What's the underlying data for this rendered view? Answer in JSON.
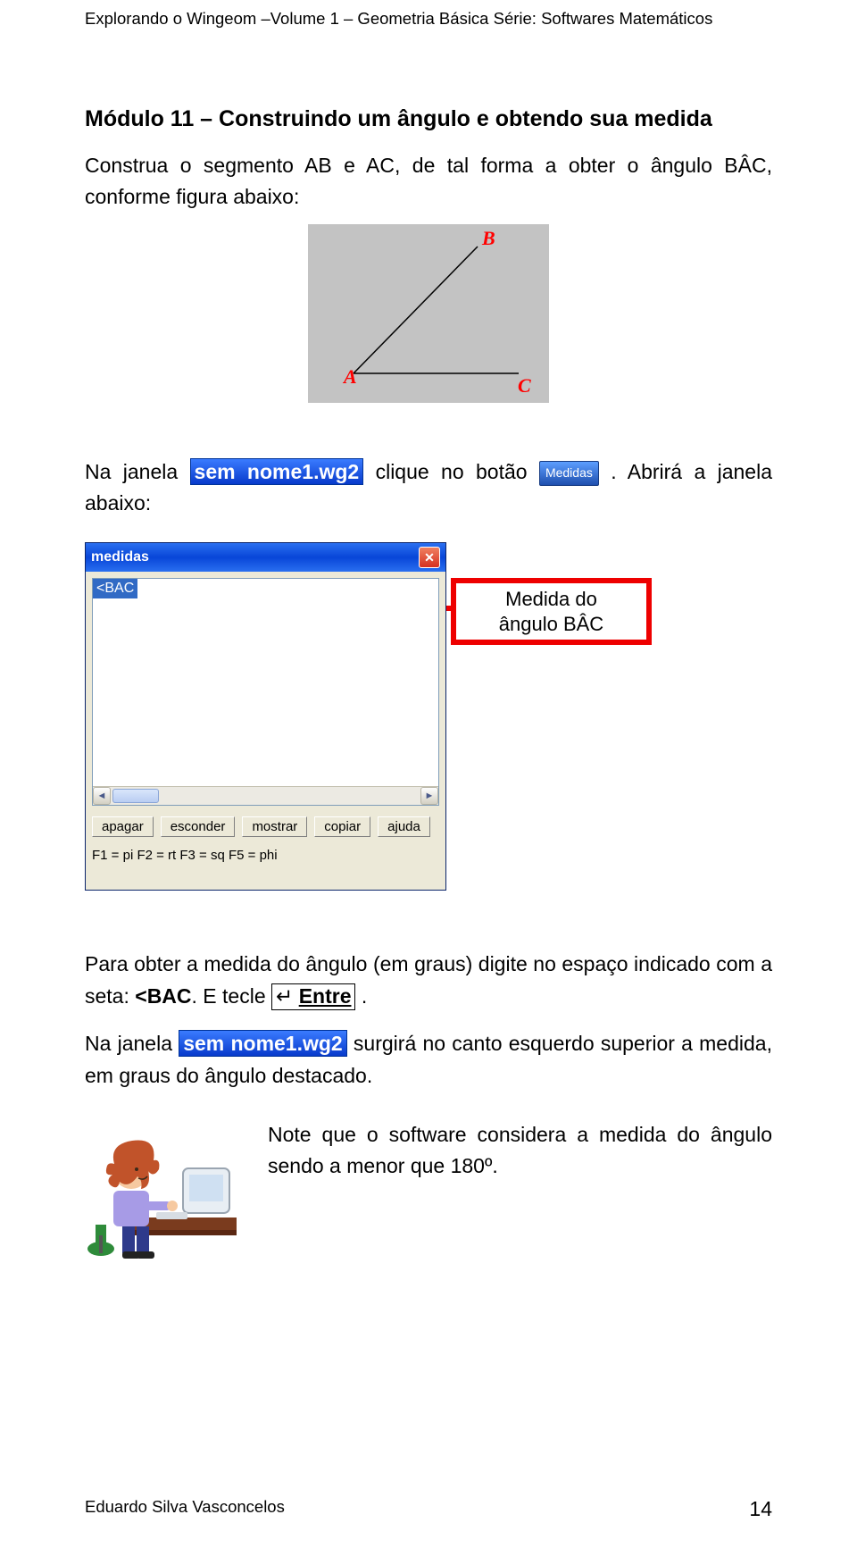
{
  "header": "Explorando o Wingeom –Volume 1 – Geometria Básica  Série: Softwares Matemáticos",
  "section_title": "Módulo 11 – Construindo um ângulo e obtendo sua medida",
  "intro_text": {
    "pre": "Construa o segmento AB e AC, de tal forma a obter o ângulo BÂC, conforme figura abaixo:"
  },
  "angle_figure": {
    "point_a": "A",
    "point_b": "B",
    "point_c": "C"
  },
  "line2": {
    "pre": "Na janela ",
    "hl": "sem nome1.wg2",
    "mid": " clique no botão ",
    "btn": "Medidas",
    "post": ". Abrirá a janela abaixo:"
  },
  "dialog": {
    "title": "medidas",
    "list_item": "<BAC",
    "buttons": [
      "apagar",
      "esconder",
      "mostrar",
      "copiar",
      "ajuda"
    ],
    "fkeys": "F1 = pi   F2 = rt   F3 = sq   F5 = phi"
  },
  "callout": {
    "line1": "Medida do",
    "line2": "ângulo BÂC"
  },
  "para2": {
    "pre": "Para obter a medida do ângulo (em graus) digite no espaço indicado com a seta: ",
    "bac": "<BAC",
    "etecle": ". E tecle ",
    "entre_symbol": "↵ ",
    "entre_label": "Entre",
    "period": " ."
  },
  "para3": {
    "pre": "Na janela ",
    "hl": "sem nome1.wg2",
    "post": " surgirá no canto esquerdo superior a medida, em graus do ângulo destacado."
  },
  "note_text": "Note que o software considera a medida do ângulo sendo a menor que 180º.",
  "footer": {
    "author": "Eduardo Silva Vasconcelos",
    "page": "14"
  }
}
